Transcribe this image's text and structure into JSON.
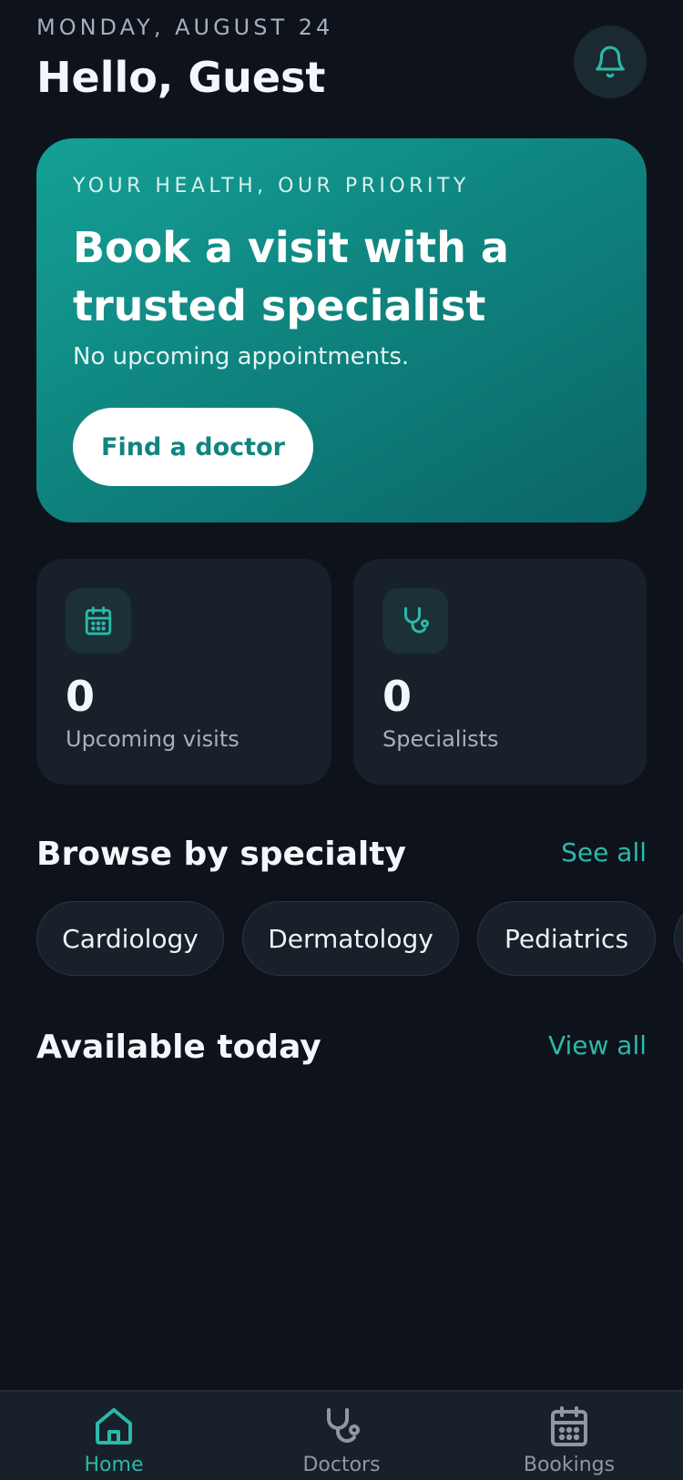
{
  "header": {
    "date": "MONDAY, AUGUST 24",
    "greeting": "Hello, Guest",
    "notifications_icon": "bell-icon"
  },
  "hero": {
    "eyebrow": "YOUR HEALTH, OUR PRIORITY",
    "title": "Book a visit with a trusted specialist",
    "subtitle": "No upcoming appointments.",
    "cta_label": "Find a doctor"
  },
  "stats": [
    {
      "icon": "calendar-icon",
      "value": "0",
      "label": "Upcoming visits"
    },
    {
      "icon": "stethoscope-icon",
      "value": "0",
      "label": "Specialists"
    }
  ],
  "specialties": {
    "title": "Browse by specialty",
    "link": "See all",
    "chips": [
      "Cardiology",
      "Dermatology",
      "Pediatrics"
    ]
  },
  "available": {
    "title": "Available today",
    "link": "View all"
  },
  "bottom_nav": {
    "items": [
      {
        "label": "Home",
        "icon": "home-icon",
        "active": true
      },
      {
        "label": "Doctors",
        "icon": "stethoscope-icon",
        "active": false
      },
      {
        "label": "Bookings",
        "icon": "calendar-icon",
        "active": false
      }
    ]
  },
  "colors": {
    "background": "#0e131b",
    "card": "#182029",
    "accent": "#2bb9a9",
    "hero_start": "#14a196",
    "hero_end": "#0b6566"
  }
}
